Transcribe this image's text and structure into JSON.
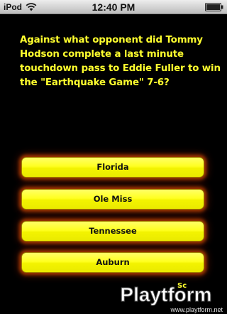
{
  "status_bar": {
    "carrier": "iPod",
    "time": "12:40 PM",
    "wifi_icon": "wifi-icon",
    "battery_icon": "battery-icon"
  },
  "quiz": {
    "question": "Against what opponent did Tommy Hodson complete a last minute touchdown pass to Eddie Fuller to win the \"Earthquake Game\" 7-6?",
    "answers": [
      "Florida",
      "Ole Miss",
      "Tennessee",
      "Auburn"
    ],
    "score_label": "Sc"
  },
  "watermark": {
    "logo_text": "Playtform",
    "url": "www.playtform.net"
  },
  "colors": {
    "background": "#000000",
    "question_text": "#ffff2e",
    "answer_button": "#ffff20",
    "answer_glow": "#c84600"
  }
}
